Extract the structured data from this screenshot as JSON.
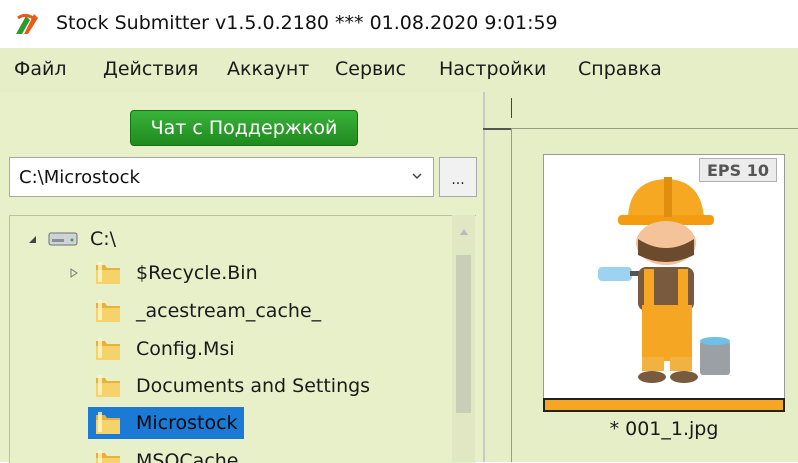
{
  "window": {
    "title": "Stock Submitter v1.5.0.2180 ***  01.08.2020 9:01:59",
    "icon": "stock-submitter-logo"
  },
  "menu": [
    "Файл",
    "Действия",
    "Аккаунт",
    "Сервис",
    "Настройки",
    "Справка"
  ],
  "chat_button_label": "Чат с Поддержкой",
  "path_field": {
    "value": "C:\\Microstock",
    "browse_label": "..."
  },
  "tree": {
    "root": "C:\\",
    "items": [
      {
        "label": "$Recycle.Bin",
        "expandable": true,
        "selected": false
      },
      {
        "label": "_acestream_cache_",
        "expandable": false,
        "selected": false
      },
      {
        "label": "Config.Msi",
        "expandable": false,
        "selected": false
      },
      {
        "label": "Documents and Settings",
        "expandable": false,
        "selected": false
      },
      {
        "label": "Microstock",
        "expandable": false,
        "selected": true
      },
      {
        "label": "MSOCache",
        "expandable": false,
        "selected": false
      }
    ]
  },
  "preview": {
    "badge": "EPS 10",
    "file_name": "* 001_1.jpg",
    "status_bar_color": "#f5a623"
  },
  "colors": {
    "panel_bg": "#e8f0c9",
    "menu_bg": "#e6eec8",
    "chat_button": "#2ea02e",
    "selection": "#1a7ad6"
  }
}
